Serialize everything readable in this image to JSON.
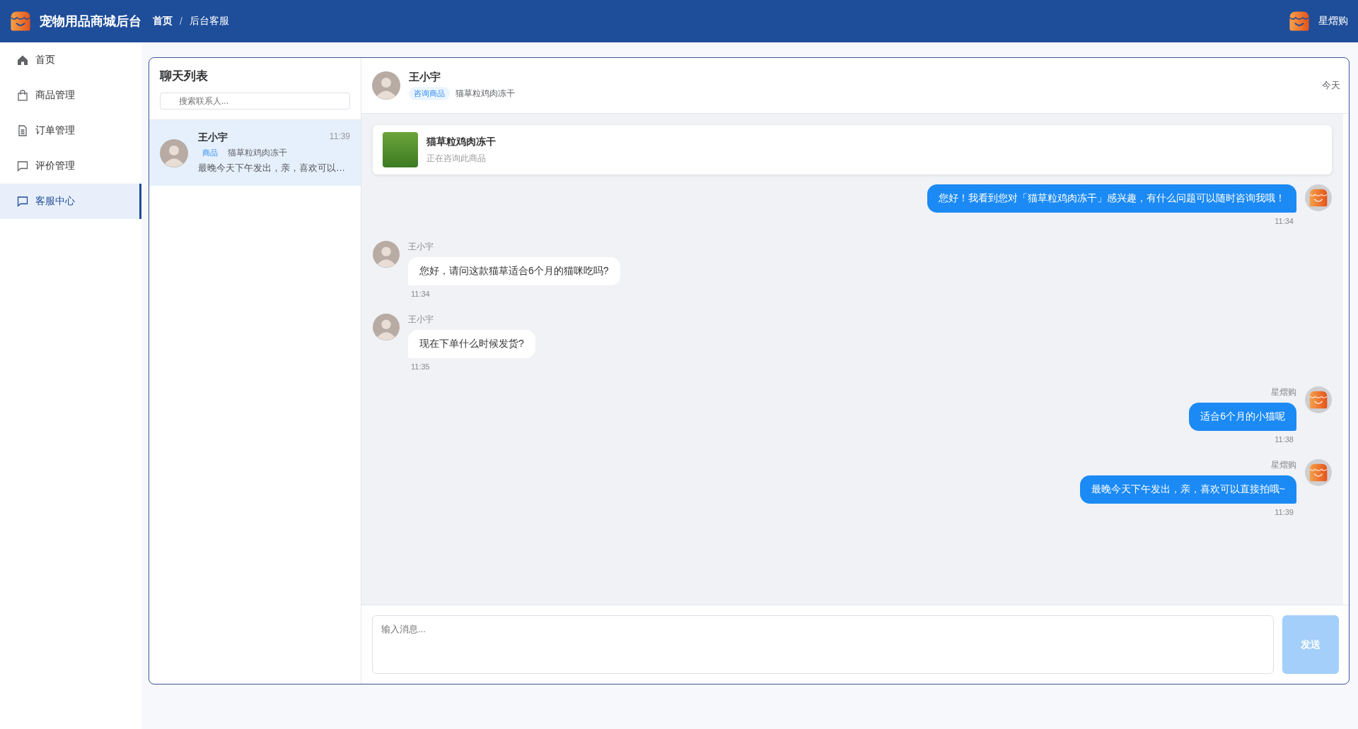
{
  "header": {
    "app_title": "宠物用品商城后台",
    "breadcrumb": [
      "首页",
      "后台客服"
    ],
    "breadcrumb_separator": "/",
    "user_name": "星熠购"
  },
  "sidebar": {
    "items": [
      {
        "label": "首页",
        "kind": "home",
        "selected": false
      },
      {
        "label": "商品管理",
        "kind": "bag",
        "selected": false
      },
      {
        "label": "订单管理",
        "kind": "doc",
        "selected": false
      },
      {
        "label": "评价管理",
        "kind": "chat",
        "selected": false
      },
      {
        "label": "客服中心",
        "kind": "chat",
        "selected": true
      }
    ]
  },
  "chat_list": {
    "title": "聊天列表",
    "search": {
      "placeholder": "搜索联系人..."
    },
    "contacts": [
      {
        "name": "王小宇",
        "time": "11:39",
        "tag": "商品",
        "product": "猫草粒鸡肉冻干",
        "last_message": "最晚今天下午发出，亲，喜欢可以…",
        "selected": true
      }
    ]
  },
  "conversation": {
    "name": "王小宇",
    "tag": "咨询商品",
    "product": "猫草粒鸡肉冻干",
    "date": "今天",
    "product_card": {
      "title": "猫草粒鸡肉冻干",
      "subtitle": "正在咨询此商品"
    },
    "messages": [
      {
        "kind": "agent",
        "text": "您好！我看到您对「猫草粒鸡肉冻干」感兴趣，有什么问题可以随时咨询我哦！",
        "time": "11:34"
      },
      {
        "kind": "customer",
        "sender": "王小宇",
        "text": "您好，请问这款猫草适合6个月的猫咪吃吗?",
        "time": "11:34"
      },
      {
        "kind": "customer",
        "sender": "王小宇",
        "text": "现在下单什么时候发货?",
        "time": "11:35"
      },
      {
        "kind": "agent",
        "sender": "星熠购",
        "text": "适合6个月的小猫呢",
        "time": "11:38"
      },
      {
        "kind": "agent",
        "sender": "星熠购",
        "text": "最晚今天下午发出，亲，喜欢可以直接拍哦~",
        "time": "11:39"
      }
    ],
    "input": {
      "placeholder": "输入消息..."
    },
    "send_button": {
      "label": "发送",
      "disabled": true
    }
  }
}
